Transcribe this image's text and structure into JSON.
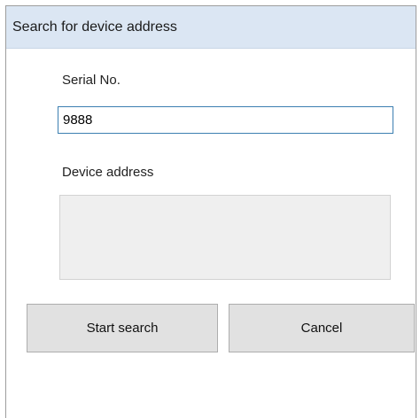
{
  "window": {
    "title": "Search for device address"
  },
  "form": {
    "serial_label": "Serial No.",
    "serial_value": "9888",
    "device_address_label": "Device address",
    "device_address_value": ""
  },
  "buttons": {
    "start_search": "Start search",
    "cancel": "Cancel"
  },
  "colors": {
    "titlebar_bg": "#dbe6f3",
    "input_border_focus": "#3c7fb1",
    "button_bg": "#e1e1e1",
    "readonly_box_bg": "#efefef"
  }
}
